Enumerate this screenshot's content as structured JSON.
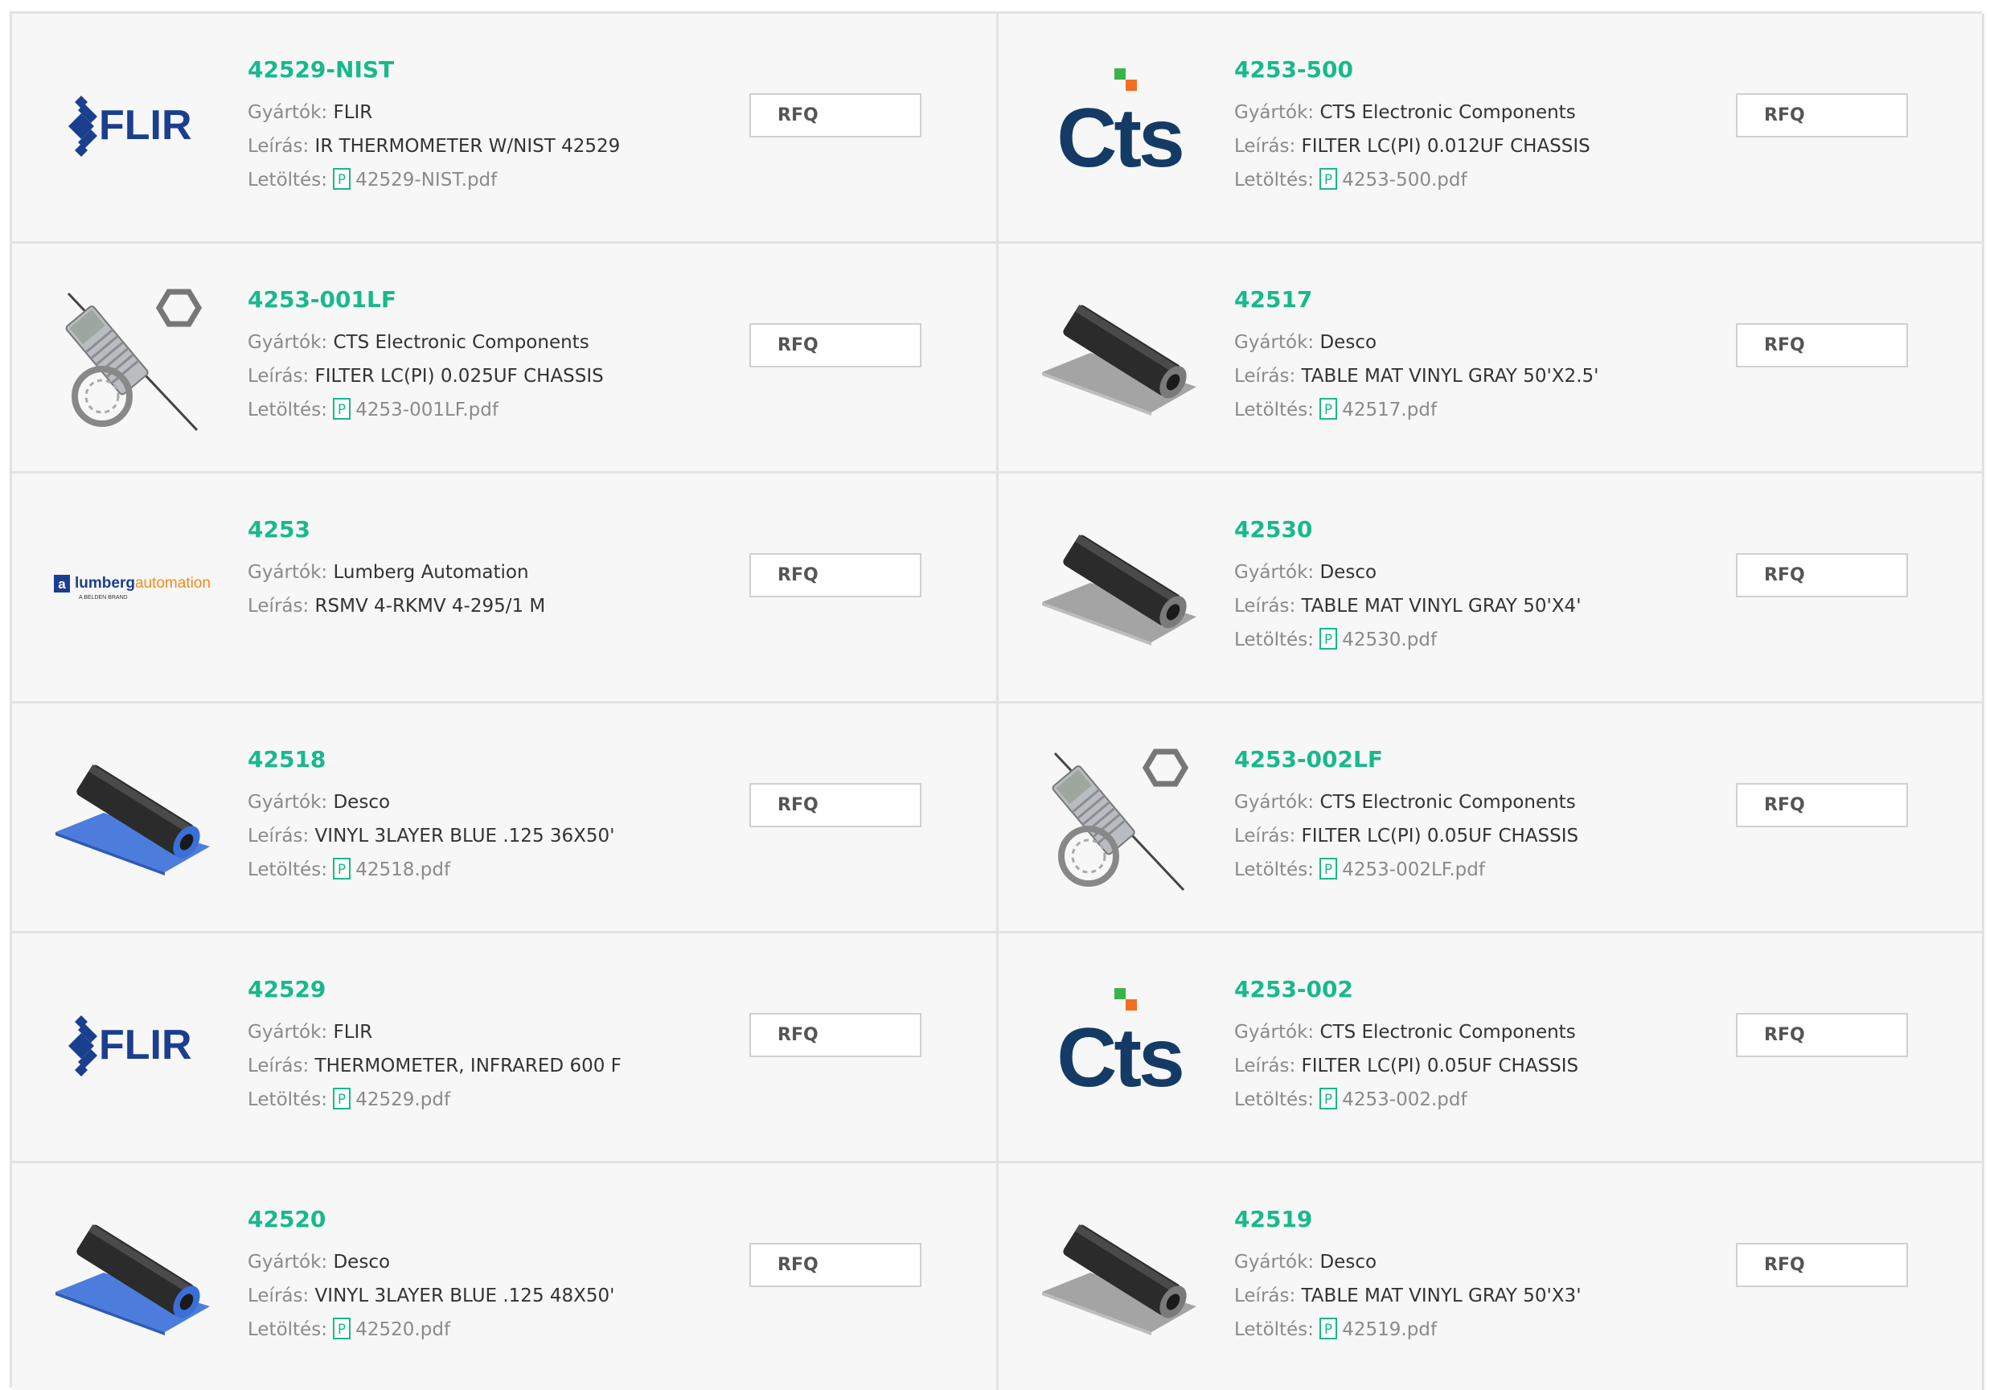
{
  "labels": {
    "manufacturer": "Gyártók:",
    "description": "Leírás:",
    "download": "Letöltés:",
    "rfq": "RFQ"
  },
  "colors": {
    "accent_green": "#18b98c",
    "label_gray": "#8a8a8a",
    "text_dark": "#333333",
    "border": "#e2e2e2",
    "cell_bg": "#f7f7f7",
    "flir_blue": "#1b3f8f",
    "cts_navy": "#143b66",
    "cts_green": "#3bb34a",
    "cts_orange": "#f26f22",
    "mat_blue": "#3a6fd8",
    "lumberg_orange": "#f28c1a"
  },
  "logo_text": {
    "flir": "FLIR",
    "cts": "CTS",
    "lumberg": "lumbergautomation",
    "lumberg_sub": "A BELDEN BRAND"
  },
  "products": [
    {
      "part": "42529-NIST",
      "manufacturer": "FLIR",
      "description": "IR THERMOMETER W/NIST 42529",
      "file": "42529-NIST.pdf",
      "image": "flir-logo"
    },
    {
      "part": "4253-500",
      "manufacturer": "CTS Electronic Components",
      "description": "FILTER LC(PI) 0.012UF CHASSIS",
      "file": "4253-500.pdf",
      "image": "cts-logo"
    },
    {
      "part": "4253-001LF",
      "manufacturer": "CTS Electronic Components",
      "description": "FILTER LC(PI) 0.025UF CHASSIS",
      "file": "4253-001LF.pdf",
      "image": "filter-part-image"
    },
    {
      "part": "42517",
      "manufacturer": "Desco",
      "description": "TABLE MAT VINYL GRAY 50'X2.5'",
      "file": "42517.pdf",
      "image": "gray-mat-roll-image"
    },
    {
      "part": "4253",
      "manufacturer": "Lumberg Automation",
      "description": "RSMV 4-RKMV 4-295/1 M",
      "file": "",
      "image": "lumberg-logo"
    },
    {
      "part": "42530",
      "manufacturer": "Desco",
      "description": "TABLE MAT VINYL GRAY 50'X4'",
      "file": "42530.pdf",
      "image": "gray-mat-roll-image"
    },
    {
      "part": "42518",
      "manufacturer": "Desco",
      "description": "VINYL 3LAYER BLUE .125 36X50'",
      "file": "42518.pdf",
      "image": "blue-mat-roll-image"
    },
    {
      "part": "4253-002LF",
      "manufacturer": "CTS Electronic Components",
      "description": "FILTER LC(PI) 0.05UF CHASSIS",
      "file": "4253-002LF.pdf",
      "image": "filter-part-image"
    },
    {
      "part": "42529",
      "manufacturer": "FLIR",
      "description": "THERMOMETER, INFRARED 600 F",
      "file": "42529.pdf",
      "image": "flir-logo"
    },
    {
      "part": "4253-002",
      "manufacturer": "CTS Electronic Components",
      "description": "FILTER LC(PI) 0.05UF CHASSIS",
      "file": "4253-002.pdf",
      "image": "cts-logo"
    },
    {
      "part": "42520",
      "manufacturer": "Desco",
      "description": "VINYL 3LAYER BLUE .125 48X50'",
      "file": "42520.pdf",
      "image": "blue-mat-roll-image"
    },
    {
      "part": "42519",
      "manufacturer": "Desco",
      "description": "TABLE MAT VINYL GRAY 50'X3'",
      "file": "42519.pdf",
      "image": "gray-mat-roll-image"
    }
  ]
}
